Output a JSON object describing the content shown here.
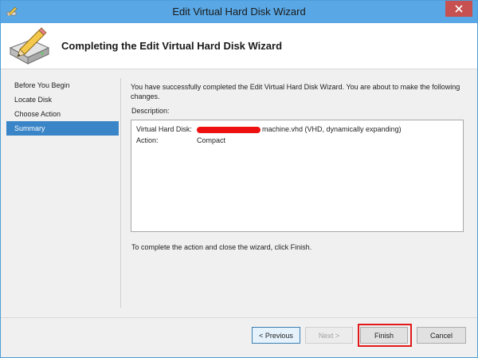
{
  "window": {
    "title": "Edit Virtual Hard Disk Wizard",
    "close_label": "×"
  },
  "header": {
    "title": "Completing the Edit Virtual Hard Disk Wizard"
  },
  "nav": {
    "items": [
      {
        "label": "Before You Begin"
      },
      {
        "label": "Locate Disk"
      },
      {
        "label": "Choose Action"
      },
      {
        "label": "Summary",
        "active": true
      }
    ]
  },
  "main": {
    "intro_text": "You have successfully completed the Edit Virtual Hard Disk Wizard. You are about to make the following changes.",
    "description_label": "Description:",
    "description_rows": [
      {
        "key": "Virtual Hard Disk:",
        "value": "machine.vhd (VHD, dynamically expanding)",
        "redacted_prefix": true
      },
      {
        "key": "Action:",
        "value": "Compact"
      }
    ],
    "complete_text": "To complete the action and close the wizard, click Finish."
  },
  "buttons": {
    "previous": "< Previous",
    "next": "Next >",
    "finish": "Finish",
    "cancel": "Cancel"
  },
  "colors": {
    "titlebar": "#59a7e4",
    "close": "#c75050",
    "nav_active": "#3a85c7",
    "highlight": "#e21a1a"
  }
}
